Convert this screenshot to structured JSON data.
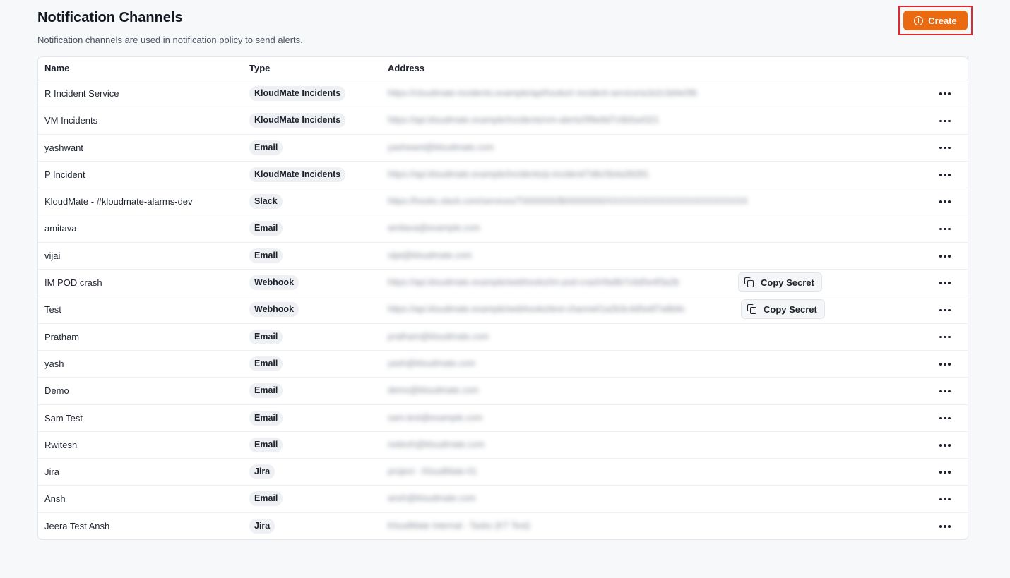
{
  "header": {
    "title": "Notification Channels",
    "subtitle": "Notification channels are used in notification policy to send alerts.",
    "create_label": "Create"
  },
  "table": {
    "columns": {
      "name": "Name",
      "type": "Type",
      "address": "Address"
    },
    "copy_secret_label": "Copy Secret",
    "rows": [
      {
        "name": "R Incident Service",
        "type": "KloudMate Incidents",
        "address": "https://cloudmate-incidents.example/api/hooks/r-incident-service/a1b2c3d4e5f6",
        "copy_secret": false
      },
      {
        "name": "VM Incidents",
        "type": "KloudMate Incidents",
        "address": "https://api.kloudmate.example/incidents/vm-alerts/0f9e8d7c6b5a4321",
        "copy_secret": false
      },
      {
        "name": "yashwant",
        "type": "Email",
        "address": "yashwant@kloudmate.com",
        "copy_secret": false
      },
      {
        "name": "P Incident",
        "type": "KloudMate Incidents",
        "address": "https://api.kloudmate.example/incidents/p-incident/7d6c5b4a39281",
        "copy_secret": false
      },
      {
        "name": "KloudMate - #kloudmate-alarms-dev",
        "type": "Slack",
        "address": "https://hooks.slack.com/services/T0000000/B00000000/XXXXXXXXXXXXXXXXXXXXXXXX",
        "copy_secret": false
      },
      {
        "name": "amitava",
        "type": "Email",
        "address": "amitava@example.com",
        "copy_secret": false
      },
      {
        "name": "vijai",
        "type": "Email",
        "address": "vijai@kloudmate.com",
        "copy_secret": false
      },
      {
        "name": "IM POD crash",
        "type": "Webhook",
        "address": "https://api.kloudmate.example/webhooks/im-pod-crash/9a8b7c6d5e4f3a2b",
        "copy_secret": true
      },
      {
        "name": "Test",
        "type": "Webhook",
        "address": "https://api.kloudmate.example/webhooks/test-channel/1a2b3c4d5e6f7a8b9c",
        "copy_secret": true
      },
      {
        "name": "Pratham",
        "type": "Email",
        "address": "pratham@kloudmate.com",
        "copy_secret": false
      },
      {
        "name": "yash",
        "type": "Email",
        "address": "yash@kloudmate.com",
        "copy_secret": false
      },
      {
        "name": "Demo",
        "type": "Email",
        "address": "demo@kloudmate.com",
        "copy_secret": false
      },
      {
        "name": "Sam Test",
        "type": "Email",
        "address": "sam.test@example.com",
        "copy_secret": false
      },
      {
        "name": "Rwitesh",
        "type": "Email",
        "address": "rwitesh@kloudmate.com",
        "copy_secret": false
      },
      {
        "name": "Jira",
        "type": "Jira",
        "address": "project - KloudMate-01",
        "copy_secret": false
      },
      {
        "name": "Ansh",
        "type": "Email",
        "address": "ansh@kloudmate.com",
        "copy_secret": false
      },
      {
        "name": "Jeera Test Ansh",
        "type": "Jira",
        "address": "KloudMate Internal - Tasks (KT Test)",
        "copy_secret": false
      }
    ]
  }
}
